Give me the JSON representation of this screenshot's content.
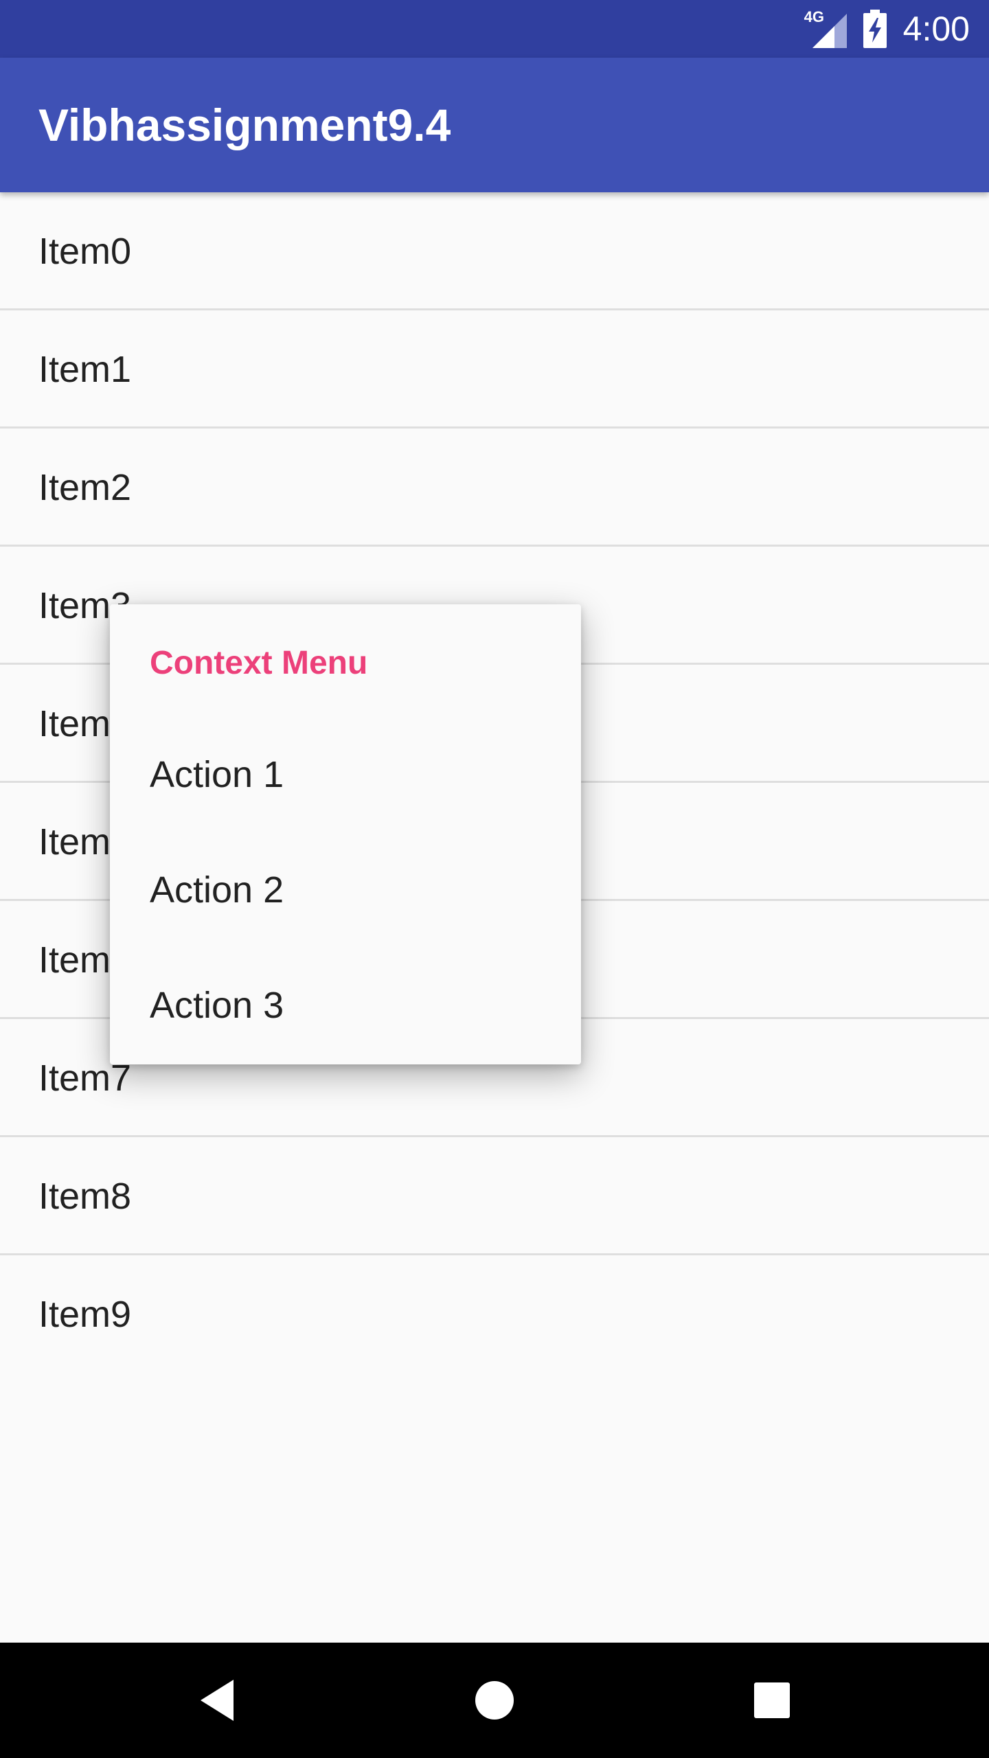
{
  "status_bar": {
    "network_label": "4G",
    "time": "4:00",
    "background_color": "#303f9f"
  },
  "app_bar": {
    "title": "Vibhassignment9.4",
    "background_color": "#3f51b5"
  },
  "list": {
    "items": [
      {
        "label": "Item0"
      },
      {
        "label": "Item1"
      },
      {
        "label": "Item2"
      },
      {
        "label": "Item3"
      },
      {
        "label": "Item4"
      },
      {
        "label": "Item5"
      },
      {
        "label": "Item6"
      },
      {
        "label": "Item7"
      },
      {
        "label": "Item8"
      },
      {
        "label": "Item9"
      }
    ]
  },
  "context_menu": {
    "title": "Context Menu",
    "title_color": "#ec407a",
    "actions": [
      {
        "label": "Action 1"
      },
      {
        "label": "Action 2"
      },
      {
        "label": "Action 3"
      }
    ]
  },
  "nav_bar": {
    "icons": [
      "back-icon",
      "home-icon",
      "recents-icon"
    ]
  }
}
